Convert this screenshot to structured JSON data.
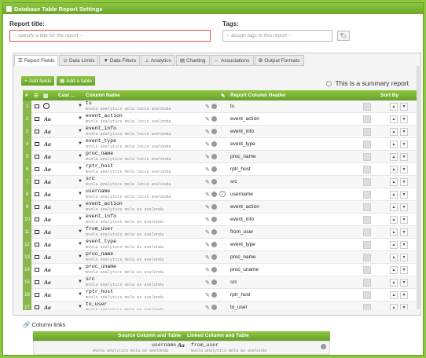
{
  "window": {
    "title": "Database Table Report Settings"
  },
  "form": {
    "report_title_label": "Report title:",
    "report_title_placeholder": "-- specify a title for the report --",
    "tags_label": "Tags:",
    "tags_placeholder": "-- assign tags to this report --"
  },
  "tabs": [
    {
      "label": "Report Fields",
      "icon": "list-icon",
      "active": true
    },
    {
      "label": "Data Limits",
      "icon": "limit-icon"
    },
    {
      "label": "Data Filters",
      "icon": "filter-icon"
    },
    {
      "label": "Analytics",
      "icon": "analytics-icon"
    },
    {
      "label": "Charting",
      "icon": "chart-icon"
    },
    {
      "label": "Associations",
      "icon": "association-icon"
    },
    {
      "label": "Output Formats",
      "icon": "output-icon"
    }
  ],
  "toolbar": {
    "add_fields": "Add fields",
    "add_table": "Add a table",
    "summary_label": "This is a summary report"
  },
  "grid": {
    "headers": {
      "num": "#",
      "cast": "Cast ...",
      "column": "Column Name",
      "edit": "✎",
      "report_header": "Report Column Header",
      "sort": "Sort By"
    },
    "rows": [
      {
        "n": "1",
        "col": "ts",
        "sub": "mvola analytics mola locis avelonda",
        "header": "ts",
        "icon": "clock"
      },
      {
        "n": "2",
        "col": "event_action",
        "sub": "mvola analytics mola locis avelonda",
        "header": "event_action"
      },
      {
        "n": "3",
        "col": "event_info",
        "sub": "mvola analytics mola locis avelonda",
        "header": "event_info"
      },
      {
        "n": "4",
        "col": "event_type",
        "sub": "mvola analytics mola locis avelonda",
        "header": "event_type"
      },
      {
        "n": "5",
        "col": "proc_name",
        "sub": "mvola analytics mola locis avelonda",
        "header": "proc_name"
      },
      {
        "n": "6",
        "col": "rptr_host",
        "sub": "mvola analytics mola locis avelonda",
        "header": "rptr_host"
      },
      {
        "n": "7",
        "col": "src",
        "sub": "mvola analytics mola locis avelonda",
        "header": "src"
      },
      {
        "n": "8",
        "col": "username",
        "sub": "mvola analytics mola locis avelonda",
        "header": "username",
        "info": true
      },
      {
        "n": "9",
        "col": "event_action",
        "sub": "mvola analytics mola as avelonda",
        "header": "event_action"
      },
      {
        "n": "10",
        "col": "event_info",
        "sub": "mvola analytics mola as avelonda",
        "header": "event_info"
      },
      {
        "n": "11",
        "col": "from_user",
        "sub": "mvola analytics mola as avelonda",
        "header": "from_user"
      },
      {
        "n": "12",
        "col": "event_type",
        "sub": "mvola analytics mola as avelonda",
        "header": "event_type"
      },
      {
        "n": "13",
        "col": "proc_name",
        "sub": "mvola analytics mola as avelonda",
        "header": "proc_name"
      },
      {
        "n": "14",
        "col": "proc_uname",
        "sub": "mvola analytics mola as avelonda",
        "header": "proc_uname"
      },
      {
        "n": "15",
        "col": "src",
        "sub": "mvola analytics mola as avelonda",
        "header": "src"
      },
      {
        "n": "16",
        "col": "rptr_host",
        "sub": "mvola analytics mola as avelonda",
        "header": "rptr_host"
      },
      {
        "n": "17",
        "col": "to_user",
        "sub": "mvola analytics mola as avelonda",
        "header": "to_user"
      }
    ]
  },
  "links": {
    "title": "Column links",
    "source_header": "Source Column and Table",
    "linked_header": "Linked Column and Table",
    "row_source": "username",
    "row_linked": "from_user",
    "row_sub": "mvola analytics mola as avelonda"
  },
  "colors": {
    "accent": "#7ab538",
    "frame": "#8cc83a"
  }
}
